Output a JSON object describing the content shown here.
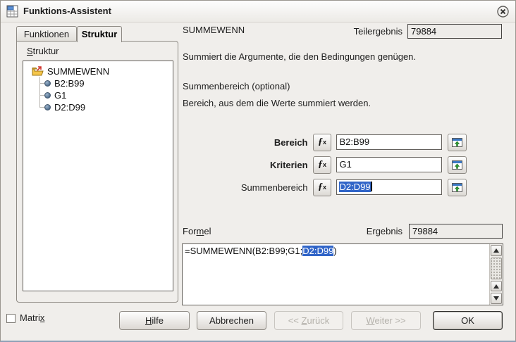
{
  "titlebar": {
    "title": "Funktions-Assistent"
  },
  "tabs": {
    "funktionen": "Funktionen",
    "struktur": "Struktur"
  },
  "panel": {
    "label_u": "S",
    "label_rest": "truktur"
  },
  "tree": {
    "root": "SUMMEWENN",
    "children": [
      "B2:B99",
      "G1",
      "D2:D99"
    ]
  },
  "main": {
    "function_name": "SUMMEWENN",
    "teilergebnis_label": "Teilergebnis",
    "teilergebnis_value": "79884",
    "description": "Summiert die Argumente, die den Bedingungen genügen.",
    "arg_title": "Summenbereich (optional)",
    "arg_help": "Bereich, aus dem die Werte summiert werden.",
    "rows": [
      {
        "label": "Bereich",
        "value": "B2:B99"
      },
      {
        "label": "Kriterien",
        "value": "G1"
      },
      {
        "label": "Summenbereich",
        "value": "D2:D99"
      }
    ],
    "formel_pre": "For",
    "formel_u": "m",
    "formel_post": "el",
    "ergebnis_label": "Ergebnis",
    "ergebnis_value": "79884",
    "formula_pre": "=SUMMEWENN(B2:B99;G1;",
    "formula_sel": "D2:D99",
    "formula_post": ")"
  },
  "icons": {
    "fx_f": "ƒ",
    "fx_sub": "x"
  },
  "footer": {
    "matrix_pre": "Matri",
    "matrix_u": "x",
    "hilfe_u": "H",
    "hilfe_rest": "ilfe",
    "abbrechen": "Abbrechen",
    "zurueck_pre": "<< ",
    "zurueck_u": "Z",
    "zurueck_rest": "urück",
    "weiter_u": "W",
    "weiter_rest": "eiter >>",
    "ok": "OK"
  },
  "colors": {
    "selection_bg": "#3165c8",
    "selection_text": "#ffffff",
    "dialog_bg": "#f0eeeb"
  }
}
